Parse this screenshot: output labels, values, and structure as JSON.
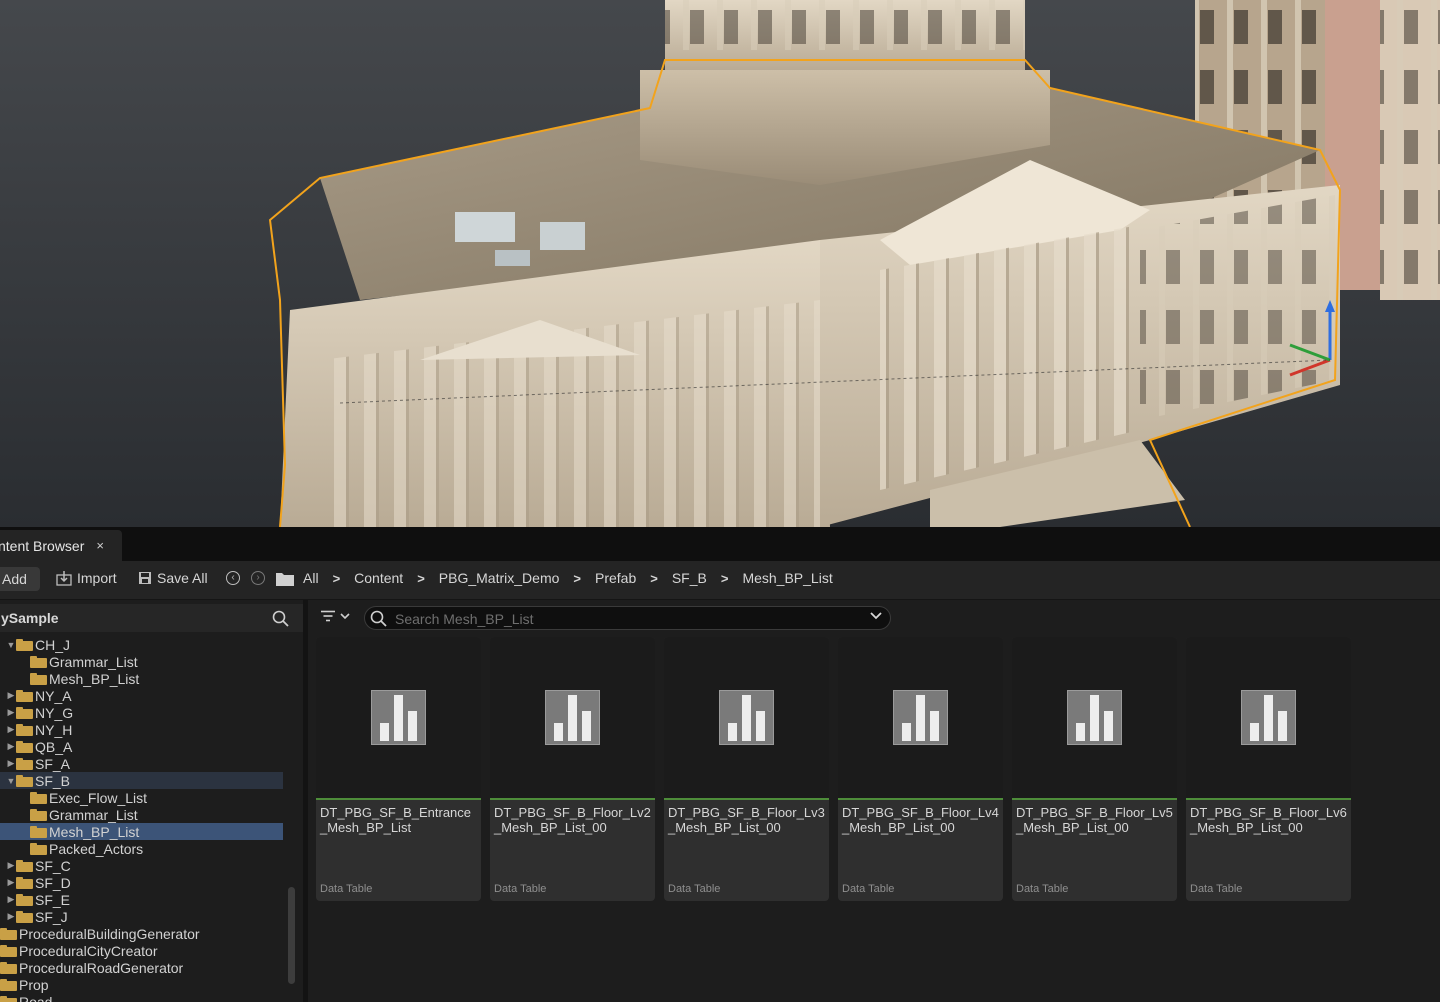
{
  "tab": {
    "title": "ntent Browser",
    "close": "×"
  },
  "toolbar": {
    "add_label": "Add",
    "import_label": "Import",
    "saveall_label": "Save All"
  },
  "breadcrumb": [
    "All",
    "Content",
    "PBG_Matrix_Demo",
    "Prefab",
    "SF_B",
    "Mesh_BP_List"
  ],
  "tree": {
    "title": "ySample",
    "items": [
      {
        "label": "CH_J",
        "arrow": "▼",
        "open": true
      },
      {
        "label": "Grammar_List",
        "arrow": ""
      },
      {
        "label": "Mesh_BP_List",
        "arrow": ""
      },
      {
        "label": "NY_A",
        "arrow": "▶"
      },
      {
        "label": "NY_G",
        "arrow": "▶"
      },
      {
        "label": "NY_H",
        "arrow": "▶"
      },
      {
        "label": "QB_A",
        "arrow": "▶"
      },
      {
        "label": "SF_A",
        "arrow": "▶"
      },
      {
        "label": "SF_B",
        "arrow": "▼",
        "open": true
      },
      {
        "label": "Exec_Flow_List",
        "arrow": ""
      },
      {
        "label": "Grammar_List",
        "arrow": ""
      },
      {
        "label": "Mesh_BP_List",
        "arrow": "",
        "selected": true
      },
      {
        "label": "Packed_Actors",
        "arrow": ""
      },
      {
        "label": "SF_C",
        "arrow": "▶"
      },
      {
        "label": "SF_D",
        "arrow": "▶"
      },
      {
        "label": "SF_E",
        "arrow": "▶"
      },
      {
        "label": "SF_J",
        "arrow": "▶"
      },
      {
        "label": "ProceduralBuildingGenerator",
        "arrow": ""
      },
      {
        "label": "ProceduralCityCreator",
        "arrow": ""
      },
      {
        "label": "ProceduralRoadGenerator",
        "arrow": ""
      },
      {
        "label": "Prop",
        "arrow": ""
      },
      {
        "label": "Road",
        "arrow": ""
      }
    ]
  },
  "search": {
    "placeholder": "Search Mesh_BP_List"
  },
  "assets": [
    {
      "name": "DT_PBG_SF_B_Entrance_Mesh_BP_List",
      "type": "Data Table"
    },
    {
      "name": "DT_PBG_SF_B_Floor_Lv2_Mesh_BP_List_00",
      "type": "Data Table"
    },
    {
      "name": "DT_PBG_SF_B_Floor_Lv3_Mesh_BP_List_00",
      "type": "Data Table"
    },
    {
      "name": "DT_PBG_SF_B_Floor_Lv4_Mesh_BP_List_00",
      "type": "Data Table"
    },
    {
      "name": "DT_PBG_SF_B_Floor_Lv5_Mesh_BP_List_00",
      "type": "Data Table"
    },
    {
      "name": "DT_PBG_SF_B_Floor_Lv6_Mesh_BP_List_00",
      "type": "Data Table"
    }
  ],
  "colors": {
    "folder": "#c9a046",
    "selection": "#3c5478",
    "asset_bar": "#4e8d3a",
    "outline": "#f2a31c"
  },
  "icons": [
    "import-icon",
    "save-icon",
    "back-icon",
    "forward-icon",
    "folder-icon",
    "search-icon",
    "filter-icon",
    "chevron-down-icon",
    "data-table-icon"
  ]
}
